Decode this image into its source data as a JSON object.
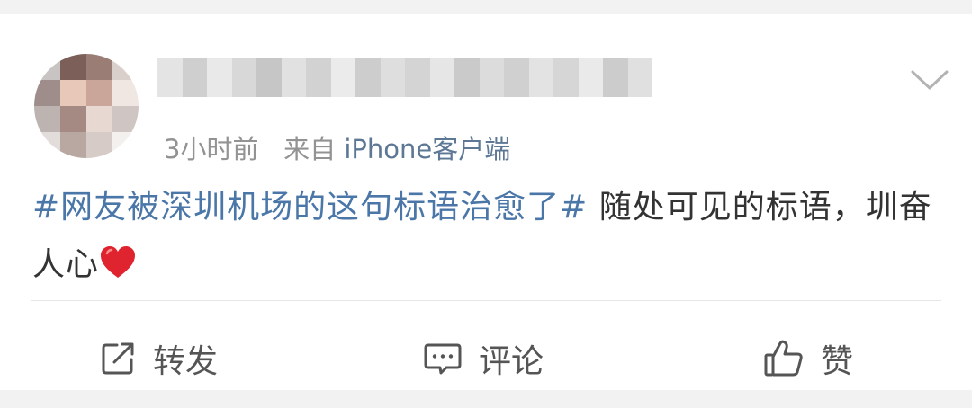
{
  "post": {
    "meta": {
      "time": "3小时前",
      "from_label": "来自",
      "source": "iPhone客户端"
    },
    "topic": "#网友被深圳机场的这句标语治愈了#",
    "body": " 随处可见的标语，圳奋人心",
    "emoji": "heart-emoji"
  },
  "actions": {
    "repost": "转发",
    "comment": "评论",
    "like": "赞"
  },
  "colors": {
    "topic": "#4a76a8",
    "source": "#5d7895",
    "text": "#333333",
    "meta": "#939393",
    "heart": "#e0242f"
  }
}
